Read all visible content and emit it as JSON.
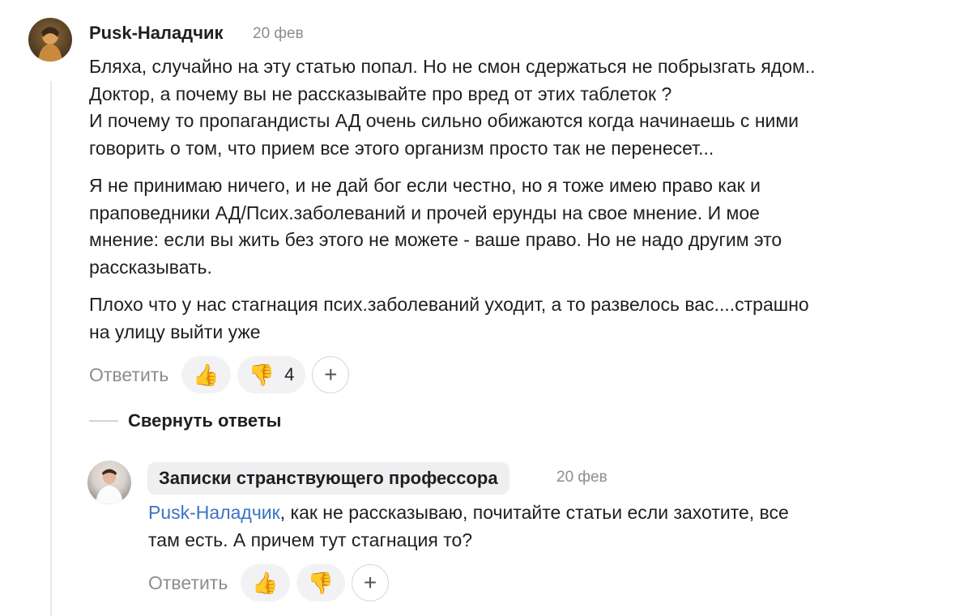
{
  "comment": {
    "author": "Pusk-Наладчик",
    "date": "20 фев",
    "paragraphs": [
      [
        "Бляха, случайно на эту статью попал. Но не смон сдержаться не побрызгать ядом..",
        "Доктор, а почему вы не рассказывайте про вред от этих таблеток ?",
        "И почему то пропагандисты АД очень сильно обижаются когда начинаешь с ними",
        "говорить о том, что прием все этого организм просто так не перенесет..."
      ],
      [
        "Я не принимаю ничего, и не дай бог если честно, но я тоже имею право как и",
        "праповедники АД/Псих.заболеваний и прочей ерунды на свое мнение. И мое",
        "мнение: если вы жить без этого не можете - ваше право. Но не надо другим это",
        "рассказывать."
      ],
      [
        "Плохо что у нас стагнация псих.заболеваний уходит, а то развелось вас....страшно",
        "на улицу выйти уже"
      ]
    ],
    "reply_label": "Ответить",
    "like_icon": "thumbs-up",
    "dislike_icon": "thumbs-down",
    "dislike_count": "4"
  },
  "collapse_label": "Свернуть ответы",
  "reply": {
    "author": "Записки странствующего профессора",
    "date": "20 фев",
    "mention": "Pusk-Наладчик",
    "text_lines": [
      ", как не рассказываю, почитайте статьи если захотите, все",
      "там есть. А причем тут стагнация то?"
    ],
    "reply_label": "Ответить"
  }
}
